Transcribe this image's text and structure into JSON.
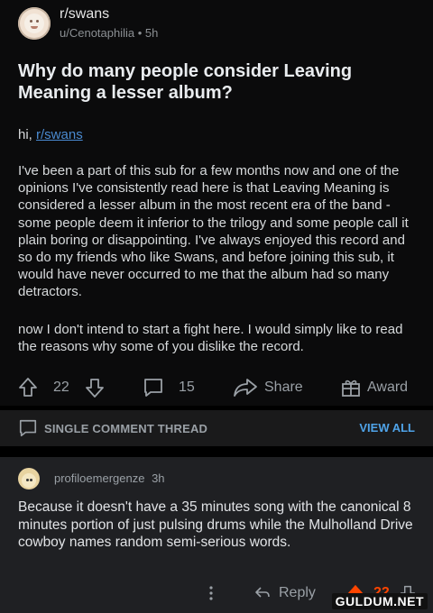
{
  "post": {
    "subreddit": "r/swans",
    "author": "u/Cenotaphilia",
    "age": "5h",
    "title": "Why do many people consider Leaving Meaning a lesser album?",
    "greeting": "hi,",
    "greeting_link": "r/swans",
    "body_1": "I've been a part of this sub for a few months now and one of the opinions I've consistently read here is that Leaving Meaning is considered a lesser album in the most recent era of the band - some people deem it inferior to the trilogy and some people call it plain boring or disappointing. I've always enjoyed this record and so do my friends who like Swans, and before joining this sub, it would have never occurred to me that the album had so many detractors.",
    "body_2": "now I don't intend to start a fight here. I would simply like to read the reasons why some of you dislike the record.",
    "upvotes": "22",
    "comments": "15",
    "share_label": "Share",
    "award_label": "Award"
  },
  "thread_bar": {
    "label": "SINGLE COMMENT THREAD",
    "view_all": "VIEW ALL"
  },
  "comment": {
    "username": "profiloemergenze",
    "age": "3h",
    "text": "Because it doesn't have a 35 minutes song with the canonical 8 minutes portion of just pulsing drums while the Mulholland Drive cowboy names random semi-serious words.",
    "reply_label": "Reply",
    "votes": "22"
  },
  "watermark": "GULDUM.NET",
  "colors": {
    "upvote_active": "#ff4500",
    "link": "#4a8ad0",
    "view_all": "#4fa3e8"
  }
}
